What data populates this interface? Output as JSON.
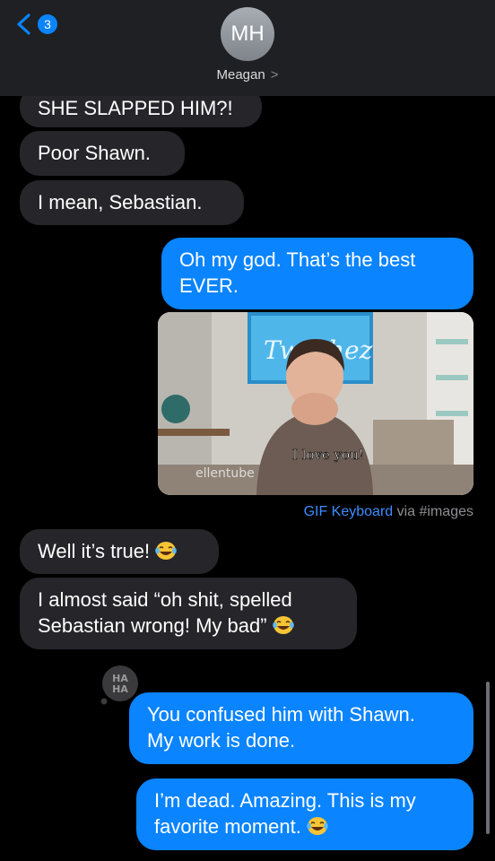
{
  "header": {
    "back_badge_count": "3",
    "avatar_initials": "MH",
    "contact_name": "Meagan",
    "contact_chevron": ">"
  },
  "messages": [
    {
      "side": "received",
      "text": "SHE SLAPPED HIM?!"
    },
    {
      "side": "received",
      "text": "Poor Shawn."
    },
    {
      "side": "received",
      "text": "I mean, Sebastian."
    },
    {
      "side": "sent",
      "line1": "Oh my god. That’s the best",
      "line2": "EVER."
    },
    {
      "side": "received",
      "text": "Well it’s true!",
      "emoji": "laughing-tears-icon"
    },
    {
      "side": "received",
      "line1": "I almost said “oh shit, spelled",
      "line2": "Sebastian wrong! My bad”",
      "emoji": "laughing-tears-icon"
    },
    {
      "side": "sent",
      "line1": "You confused him with Shawn.",
      "line2": "My work is done.",
      "tapback": "HA HA"
    },
    {
      "side": "sent",
      "line1": "I’m dead. Amazing. This is my",
      "line2": "favorite moment.",
      "emoji": "laughing-tears-icon"
    }
  ],
  "gif": {
    "overlay_text": "I love you!",
    "watermark": "ellentube",
    "sign_text": "Tw Chez",
    "caption_source": "GIF Keyboard",
    "caption_via": "via #images"
  },
  "tapback": {
    "line1": "HA",
    "line2": "HA"
  },
  "colors": {
    "sent_bubble": "#0a84ff",
    "received_bubble": "#26252a",
    "header_bg": "#1e2023",
    "background": "#000000"
  }
}
